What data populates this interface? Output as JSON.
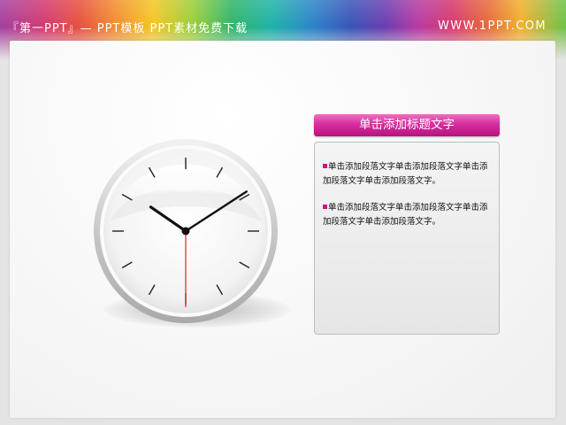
{
  "header": {
    "left_title": "『第一PPT』— PPT模板 PPT素材免费下载",
    "site_url": "WWW.1PPT.COM"
  },
  "clock": {
    "icon": "wall-clock-icon",
    "hour": 10,
    "minute": 9,
    "second": 30
  },
  "panel": {
    "title": "单击添加标题文字",
    "paragraphs": [
      "单击添加段落文字单击添加段落文字单击添加段落文字单击添加段落文字。",
      "单击添加段落文字单击添加段落文字单击添加段落文字单击添加段落文字。"
    ]
  },
  "colors": {
    "accent_magenta": "#d62e9e",
    "bullet": "#c21a8a",
    "second_hand": "#d9252c"
  }
}
